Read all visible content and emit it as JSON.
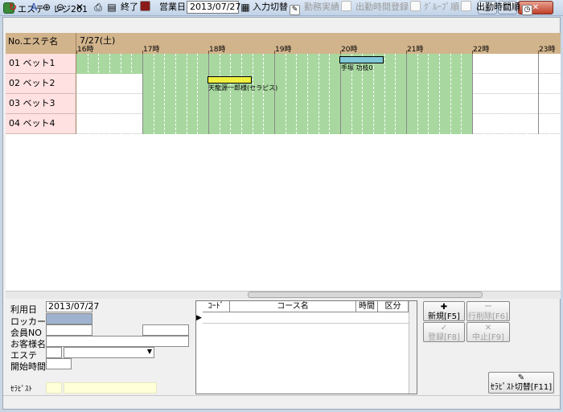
{
  "window": {
    "title": "エステ　レジ201",
    "btn_min": "_",
    "btn_max": "□",
    "btn_close": "✕"
  },
  "toolbar": {
    "exit_label": "終了",
    "business_date_label": "営業日",
    "business_date_value": "2013/07/27",
    "input_switch_label": "入力切替",
    "work_record_label": "勤務実績",
    "attendance_register_label": "出勤時間登録",
    "group_order_label": "ｸﾞﾙｰﾌﾟ順",
    "attendance_order_label": "出勤時間順"
  },
  "grid": {
    "header_left": "No.エステ名",
    "date_label": "7/27(土)",
    "hours": [
      "16時",
      "17時",
      "18時",
      "19時",
      "20時",
      "21時",
      "22時",
      "23時"
    ],
    "rows": [
      {
        "label": "01 ベット1"
      },
      {
        "label": "02 ベット2"
      },
      {
        "label": "03 ベット3"
      },
      {
        "label": "04 ベット4"
      }
    ],
    "bookings": [
      {
        "row": 1,
        "label": "手塚 功枝0",
        "color": "#7ec8d8"
      },
      {
        "row": 2,
        "label": "天龍源一郎様(セラピス)",
        "color": "#f0f040"
      }
    ]
  },
  "form": {
    "use_date_label": "利用日",
    "use_date_value": "2013/07/27",
    "locker_label": "ロッカー",
    "member_no_label": "会員NO",
    "customer_name_label": "お客様名",
    "este_label": "エステ",
    "start_time_label": "開始時間",
    "therapist_label": "ｾﾗﾋﾟｽﾄ"
  },
  "course_table": {
    "columns": [
      "ｺｰﾄﾞ",
      "コース名",
      "時間",
      "区分"
    ]
  },
  "actions": {
    "new_label": "新規[F5]",
    "delete_row_label": "行削除[F6]",
    "register_label": "登録[F8]",
    "cancel_label": "中止[F9]",
    "therapist_switch_label": "ｾﾗﾋﾟｽﾄ切替[F11]"
  }
}
